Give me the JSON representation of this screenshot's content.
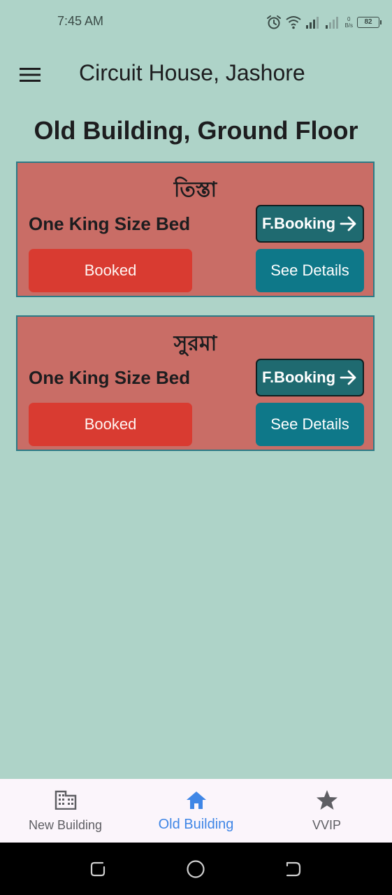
{
  "status_bar": {
    "time": "7:45 AM",
    "net_speed_value": "0",
    "net_speed_unit": "B/s",
    "battery": "82",
    "icons": [
      "alarm-icon",
      "wifi-icon",
      "signal-icon",
      "signal-icon",
      "battery-icon"
    ]
  },
  "app_bar": {
    "menu_icon": "menu-icon",
    "title": "Circuit House, Jashore"
  },
  "page": {
    "heading": "Old Building, Ground Floor"
  },
  "rooms": [
    {
      "name": "তিস্তা",
      "bed_type": "One King Size Bed",
      "fbooking_label": "F.Booking",
      "status_label": "Booked",
      "details_label": "See Details"
    },
    {
      "name": "সুরমা",
      "bed_type": "One King Size Bed",
      "fbooking_label": "F.Booking",
      "status_label": "Booked",
      "details_label": "See Details"
    }
  ],
  "bottom_nav": {
    "items": [
      {
        "label": "New Building",
        "icon": "building-icon",
        "active": false
      },
      {
        "label": "Old Building",
        "icon": "home-icon",
        "active": true
      },
      {
        "label": "VVIP",
        "icon": "star-icon",
        "active": false
      }
    ]
  },
  "colors": {
    "background": "#aed3c8",
    "card": "#c96d66",
    "booked": "#d93b31",
    "details": "#0e7889",
    "fbooking": "#1f6a70",
    "nav_active": "#3f86e6"
  }
}
